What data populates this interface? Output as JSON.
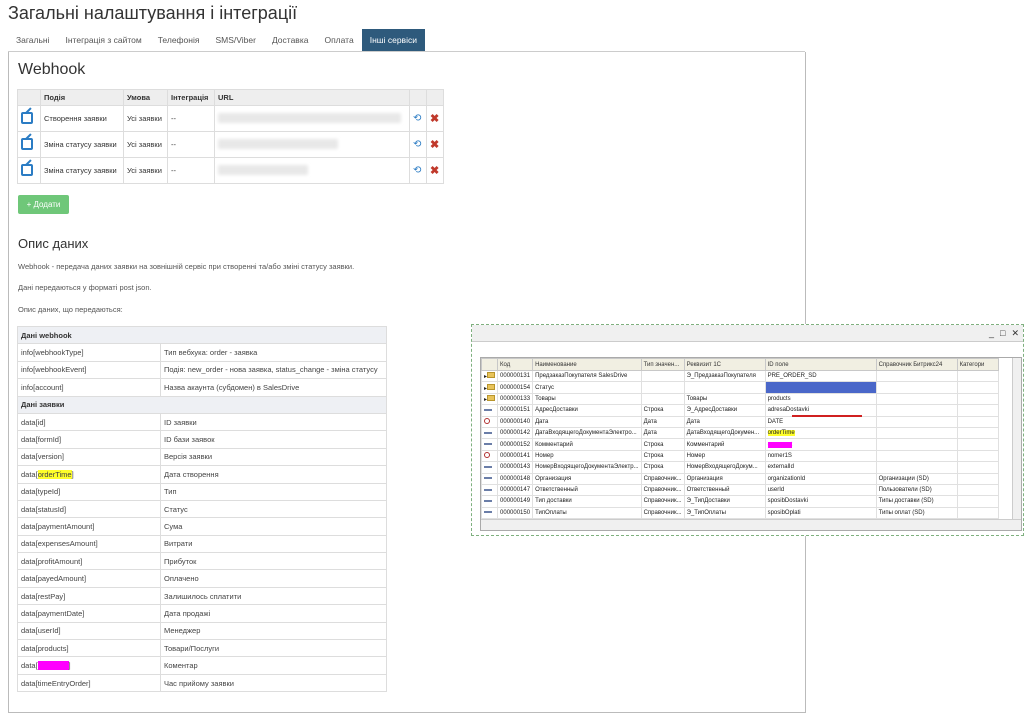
{
  "page": {
    "title": "Загальні налаштування і інтеграції",
    "tabs": [
      "Загальні",
      "Інтеграція з сайтом",
      "Телефонія",
      "SMS/Viber",
      "Доставка",
      "Оплата",
      "Інші сервіси"
    ],
    "active_tab": "Інші сервіси"
  },
  "webhook": {
    "heading": "Webhook",
    "columns": [
      "Подія",
      "Умова",
      "Інтеграція",
      "URL"
    ],
    "rows": [
      {
        "event": "Створення заявки",
        "condition": "Усі заявки",
        "integration": "--"
      },
      {
        "event": "Зміна статусу заявки",
        "condition": "Усі заявки",
        "integration": "--"
      },
      {
        "event": "Зміна статусу заявки",
        "condition": "Усі заявки",
        "integration": "--"
      }
    ],
    "add_label": "+ Додати"
  },
  "description": {
    "heading": "Опис даних",
    "p1": "Webhook - передача даних заявки на зовнішній сервіс при створенні та/або зміні статусу заявки.",
    "p2": "Дані передаються у форматі post json.",
    "p3": "Опис даних, що передаються:",
    "sections": [
      {
        "title": "Дані webhook",
        "rows": [
          {
            "key": "info[webhookType]",
            "val": "Тип вебхука: order - заявка"
          },
          {
            "key": "info[webhookEvent]",
            "val": "Подія: new_order - нова заявка, status_change - зміна статусу"
          },
          {
            "key": "info[account]",
            "val": "Назва акаунта (субдомен) в SalesDrive"
          }
        ]
      },
      {
        "title": "Дані заявки",
        "rows": [
          {
            "key": "data[id]",
            "val": "ID заявки"
          },
          {
            "key": "data[formId]",
            "val": "ID бази заявок"
          },
          {
            "key": "data[version]",
            "val": "Версія заявки"
          },
          {
            "key": "data[orderTime]",
            "val": "Дата створення",
            "hl": "yellow"
          },
          {
            "key": "data[typeId]",
            "val": "Тип"
          },
          {
            "key": "data[statusId]",
            "val": "Статус"
          },
          {
            "key": "data[paymentAmount]",
            "val": "Сума"
          },
          {
            "key": "data[expensesAmount]",
            "val": "Витрати"
          },
          {
            "key": "data[profitAmount]",
            "val": "Прибуток"
          },
          {
            "key": "data[payedAmount]",
            "val": "Оплачено"
          },
          {
            "key": "data[restPay]",
            "val": "Залишилось сплатити"
          },
          {
            "key": "data[paymentDate]",
            "val": "Дата продажі"
          },
          {
            "key": "data[userId]",
            "val": "Менеджер"
          },
          {
            "key": "data[products]",
            "val": "Товари/Послуги"
          },
          {
            "key": "data[comment]",
            "val": "Коментар",
            "hl": "magenta"
          },
          {
            "key": "data[timeEntryOrder]",
            "val": "Час прийому заявки"
          }
        ]
      }
    ]
  },
  "onec": {
    "columns": [
      "Код",
      "Наименование",
      "Тип значен...",
      "Реквизит 1С",
      "ID поле",
      "Справочник Битрикс24",
      "Категори"
    ],
    "rows": [
      {
        "icon": "folder",
        "code": "000000131",
        "name": "ПредзаказПокупателя SalesDrive",
        "type": "",
        "req": "Э_ПредзаказПокупателя",
        "id": "PRE_ORDER_SD",
        "ref": "",
        "expand": true
      },
      {
        "icon": "folder",
        "code": "000000154",
        "name": "Статус",
        "type": "",
        "req": "",
        "id": "",
        "ref": "",
        "expand": true,
        "blue": true
      },
      {
        "icon": "folder",
        "code": "000000133",
        "name": "Товары",
        "type": "",
        "req": "Товары",
        "id": "products",
        "ref": "",
        "expand": true
      },
      {
        "icon": "dash",
        "code": "000000151",
        "name": "АдресДоставки",
        "type": "Строка",
        "req": "Э_АдресДоставки",
        "id": "adresaDostavki",
        "ref": ""
      },
      {
        "icon": "key",
        "code": "000000140",
        "name": "Дата",
        "type": "Дата",
        "req": "Дата",
        "id": "DATE",
        "ref": ""
      },
      {
        "icon": "dash",
        "code": "000000142",
        "name": "ДатаВходящегоДокументаЭлектро...",
        "type": "Дата",
        "req": "ДатаВходящегоДокумен...",
        "id": "orderTime",
        "ref": "",
        "hl": "yellow"
      },
      {
        "icon": "dash",
        "code": "000000152",
        "name": "Комментарий",
        "type": "Строка",
        "req": "Комментарий",
        "id": "comment",
        "ref": "",
        "hl": "magenta"
      },
      {
        "icon": "key",
        "code": "000000141",
        "name": "Номер",
        "type": "Строка",
        "req": "Номер",
        "id": "nomer1S",
        "ref": ""
      },
      {
        "icon": "dash",
        "code": "000000143",
        "name": "НомерВходящегоДокументаЭлектр...",
        "type": "Строка",
        "req": "НомерВходящегоДокум...",
        "id": "externalId",
        "ref": ""
      },
      {
        "icon": "dash",
        "code": "000000148",
        "name": "Организация",
        "type": "Справочник...",
        "req": "Организация",
        "id": "organizationId",
        "ref": "Организации (SD)"
      },
      {
        "icon": "dash",
        "code": "000000147",
        "name": "Ответственный",
        "type": "Справочник...",
        "req": "Ответственный",
        "id": "userId",
        "ref": "Пользователи (SD)"
      },
      {
        "icon": "dash",
        "code": "000000149",
        "name": "Тип доставки",
        "type": "Справочник...",
        "req": "Э_ТипДоставки",
        "id": "sposibDostavki",
        "ref": "Типы доставки (SD)"
      },
      {
        "icon": "dash",
        "code": "000000150",
        "name": "ТипОплаты",
        "type": "Справочник...",
        "req": "Э_ТипОплаты",
        "id": "sposibOplati",
        "ref": "Типы оплат (SD)"
      }
    ]
  }
}
